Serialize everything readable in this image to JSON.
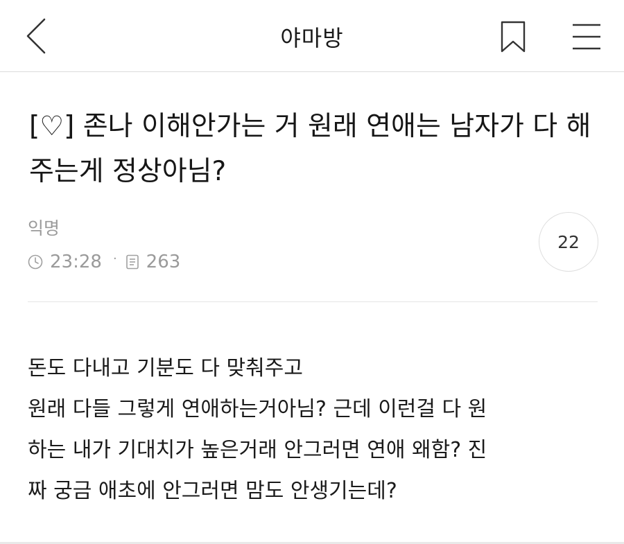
{
  "header": {
    "title": "야마방",
    "back_icon": "chevron-left-icon",
    "bookmark_icon": "bookmark-icon",
    "menu_icon": "hamburger-menu-icon"
  },
  "post": {
    "title": "[♡] 존나 이해안가는 거 원래 연애는 남자가 다 해주는게 정상아님?",
    "author": "익명",
    "time": "23:28",
    "views": "263",
    "comment_count": "22",
    "body_lines": [
      "돈도 다내고 기분도 다 맞춰주고",
      "원래 다들 그렇게 연애하는거아님? 근데 이런걸 다 원",
      "하는 내가 기대치가 높은거래 안그러면 연애 왜함? 진",
      "짜 궁금 애초에 안그러면 맘도 안생기는데?"
    ]
  },
  "colors": {
    "text": "#1a1a1a",
    "muted": "#9a9a9a",
    "divider": "#e4e4e4"
  }
}
